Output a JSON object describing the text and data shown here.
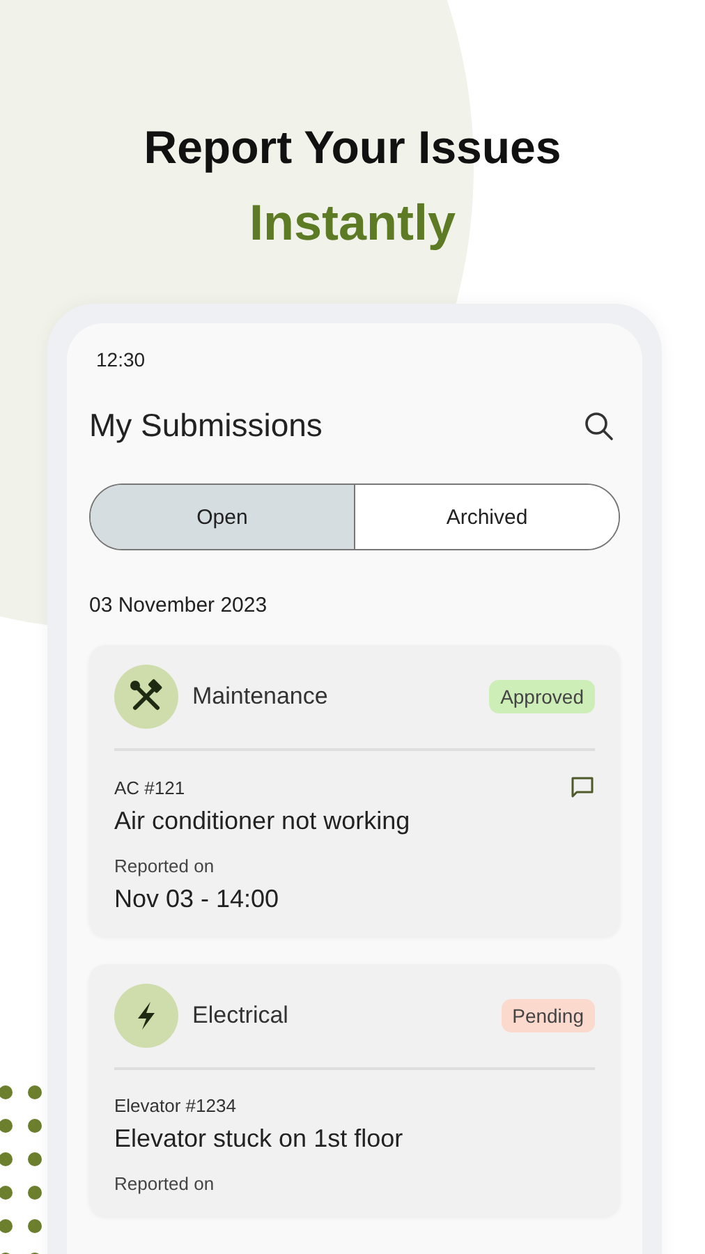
{
  "headline": {
    "line_1": "Report Your Issues",
    "line_2": "Instantly"
  },
  "phone": {
    "status_time": "12:30",
    "title": "My Submissions",
    "tabs": [
      {
        "label": "Open",
        "selected": true
      },
      {
        "label": "Archived",
        "selected": false
      }
    ],
    "date_heading": "03 November 2023",
    "submissions": [
      {
        "kind": "maintenance",
        "category": "Maintenance",
        "status": "Approved",
        "color": "#cdeeb6",
        "code": "AC #121",
        "has_comment": true,
        "title": "Air conditioner not working",
        "reported_label": "Reported on",
        "reported_at": "Nov 03 - 14:00"
      },
      {
        "kind": "electrical",
        "category": "Electrical",
        "status": "Pending",
        "color": "#fbd9cc",
        "code": "Elevator #1234",
        "has_comment": false,
        "title": "Elevator stuck on 1st floor",
        "reported_label": "Reported on"
      }
    ]
  }
}
